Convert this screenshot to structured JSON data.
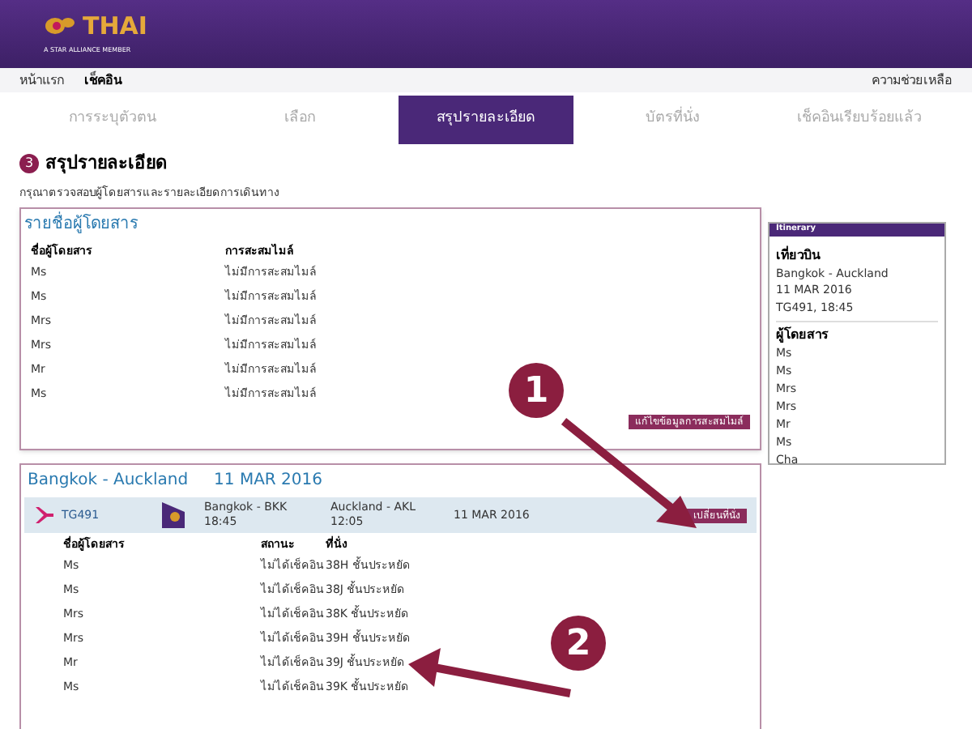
{
  "header": {
    "logo_text": "THAI",
    "tagline": "A STAR ALLIANCE MEMBER"
  },
  "nav": {
    "items": [
      {
        "label": "หน้าแรก",
        "selected": false
      },
      {
        "label": "เช็คอิน",
        "selected": true
      }
    ],
    "help": "ความช่วยเหลือ"
  },
  "steps": [
    {
      "label": "การระบุตัวตน",
      "selected": false
    },
    {
      "label": "เลือก",
      "selected": false
    },
    {
      "label": "สรุปรายละเอียด",
      "selected": true
    },
    {
      "label": "บัตรที่นั่ง",
      "selected": false
    },
    {
      "label": "เช็คอินเรียบร้อยแล้ว",
      "selected": false
    }
  ],
  "page": {
    "step_number": "3",
    "title": "สรุปรายละเอียด",
    "subtitle": "กรุณาตรวจสอบผู้โดยสารและรายละเอียดการเดินทาง"
  },
  "passenger_panel": {
    "title": "รายชื่อผู้โดยสาร",
    "columns": [
      "ชื่อผู้โดยสาร",
      "การสะสมไมล์"
    ],
    "rows": [
      {
        "name": "Ms",
        "miles": "ไม่มีการสะสมไมล์"
      },
      {
        "name": "Ms",
        "miles": "ไม่มีการสะสมไมล์"
      },
      {
        "name": "Mrs",
        "miles": "ไม่มีการสะสมไมล์"
      },
      {
        "name": "Mrs",
        "miles": "ไม่มีการสะสมไมล์"
      },
      {
        "name": "Mr",
        "miles": "ไม่มีการสะสมไมล์"
      },
      {
        "name": "Ms",
        "miles": "ไม่มีการสะสมไมล์"
      }
    ],
    "button": "แก้ไขข้อมูลการสะสมไมล์"
  },
  "flight_panel": {
    "route": "Bangkok - Auckland",
    "date": "11 MAR 2016",
    "flight": {
      "number": "TG491",
      "from": "Bangkok - BKK",
      "dep": "18:45",
      "to": "Auckland - AKL",
      "arr": "12:05",
      "date": "11 MAR 2016",
      "button": "เปลี่ยนที่นั่ง"
    },
    "columns": [
      "ชื่อผู้โดยสาร",
      "สถานะ",
      "ที่นั่ง"
    ],
    "rows": [
      {
        "name": "Ms",
        "status": "ไม่ได้เช็คอิน",
        "seat": "38H ชั้นประหยัด"
      },
      {
        "name": "Ms",
        "status": "ไม่ได้เช็คอิน",
        "seat": "38J ชั้นประหยัด"
      },
      {
        "name": "Mrs",
        "status": "ไม่ได้เช็คอิน",
        "seat": "38K ชั้นประหยัด"
      },
      {
        "name": "Mrs",
        "status": "ไม่ได้เช็คอิน",
        "seat": "39H ชั้นประหยัด"
      },
      {
        "name": "Mr",
        "status": "ไม่ได้เช็คอิน",
        "seat": "39J ชั้นประหยัด"
      },
      {
        "name": "Ms",
        "status": "ไม่ได้เช็คอิน",
        "seat": "39K ชั้นประหยัด"
      }
    ]
  },
  "itinerary": {
    "title": "Itinerary",
    "flight_heading": "เที่ยวบิน",
    "lines": [
      "Bangkok - Auckland",
      "11 MAR 2016",
      "TG491, 18:45"
    ],
    "passengers_heading": "ผู้โดยสาร",
    "passengers": [
      "Ms",
      "Ms",
      "Mrs",
      "Mrs",
      "Mr",
      "Ms",
      "Cha"
    ]
  },
  "annotations": [
    "1",
    "2"
  ]
}
